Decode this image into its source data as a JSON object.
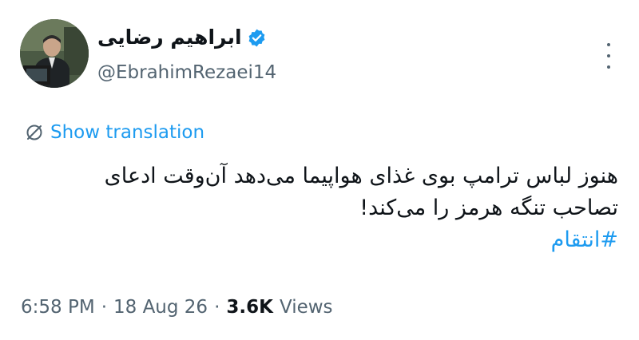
{
  "author": {
    "display_name": "ابراهیم رضایی",
    "handle": "@EbrahimRezaei14",
    "verified": true
  },
  "translation": {
    "label": "Show translation"
  },
  "tweet": {
    "line1": "هنوز لباس ترامپ بوی غذای هواپیما می‌دهد آن‌وقت ادعای",
    "line2": "تصاحب تنگه هرمز را می‌کند!",
    "hashtag": "#انتقام"
  },
  "meta": {
    "time": "6:58 PM",
    "separator1": "·",
    "date": "18 Aug 26",
    "separator2": "·",
    "views_count": "3.6K",
    "views_label": "Views"
  },
  "colors": {
    "accent": "#1d9bf0",
    "text_primary": "#0f1419",
    "text_secondary": "#536471"
  },
  "icons": {
    "verified": "verified-badge-icon",
    "translate": "translate-globe-icon",
    "more": "more-vertical-icon"
  }
}
